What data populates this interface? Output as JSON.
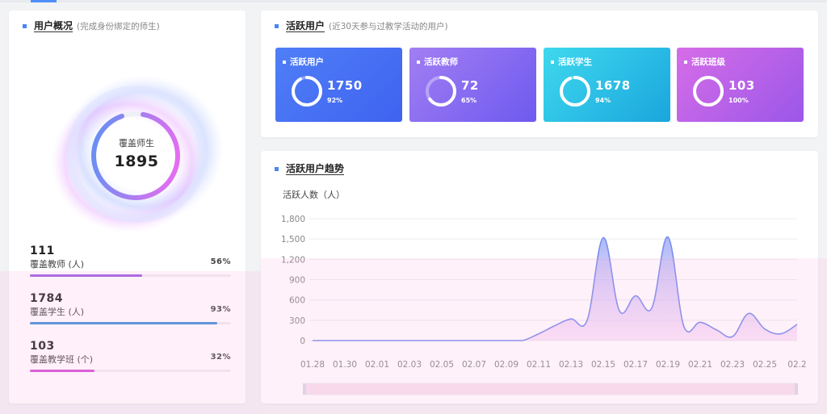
{
  "overview": {
    "title": "用户概况",
    "subtitle": "(完成身份绑定的师生)",
    "center_label": "覆盖师生",
    "center_value": "1895",
    "stats": [
      {
        "value": "111",
        "label": "覆盖教师 (人)",
        "percent": "56%",
        "fraction": 0.56,
        "color": "#9b5de5"
      },
      {
        "value": "1784",
        "label": "覆盖学生 (人)",
        "percent": "93%",
        "fraction": 0.93,
        "color": "#3e8fd8"
      },
      {
        "value": "103",
        "label": "覆盖教学班 (个)",
        "percent": "32%",
        "fraction": 0.32,
        "color": "#d64fd8"
      }
    ]
  },
  "active": {
    "title": "活跃用户",
    "subtitle": "(近30天参与过教学活动的用户)",
    "cards": [
      {
        "title": "活跃用户",
        "value": "1750",
        "percent": "92%",
        "fraction": 0.92,
        "bg_from": "#4f7ff7",
        "bg_to": "#3f62f0"
      },
      {
        "title": "活跃教师",
        "value": "72",
        "percent": "65%",
        "fraction": 0.65,
        "bg_from": "#a27ef2",
        "bg_to": "#6e5af0"
      },
      {
        "title": "活跃学生",
        "value": "1678",
        "percent": "94%",
        "fraction": 0.94,
        "bg_from": "#3fd8ee",
        "bg_to": "#1aa6dd"
      },
      {
        "title": "活跃班级",
        "value": "103",
        "percent": "100%",
        "fraction": 1.0,
        "bg_from": "#d66de8",
        "bg_to": "#9b57e8"
      }
    ]
  },
  "trend": {
    "title": "活跃用户趋势",
    "y_title": "活跃人数（人）"
  },
  "chart_data": {
    "type": "area",
    "ylabel": "活跃人数（人）",
    "ylim": [
      0,
      1800
    ],
    "yticks": [
      "1,800",
      "1,500",
      "1,200",
      "900",
      "600",
      "300",
      "0"
    ],
    "xtick_labels": [
      "01.28",
      "01.30",
      "02.01",
      "02.03",
      "02.05",
      "02.07",
      "02.09",
      "02.11",
      "02.13",
      "02.15",
      "02.17",
      "02.19",
      "02.21",
      "02.23",
      "02.25",
      "02.2"
    ],
    "x": [
      "01.28",
      "01.29",
      "01.30",
      "01.31",
      "02.01",
      "02.02",
      "02.03",
      "02.04",
      "02.05",
      "02.06",
      "02.07",
      "02.08",
      "02.09",
      "02.10",
      "02.11",
      "02.12",
      "02.13",
      "02.14",
      "02.15",
      "02.16",
      "02.17",
      "02.18",
      "02.19",
      "02.20",
      "02.21",
      "02.22",
      "02.23",
      "02.24",
      "02.25",
      "02.26",
      "02.27"
    ],
    "values": [
      0,
      0,
      0,
      0,
      0,
      0,
      0,
      0,
      0,
      0,
      0,
      0,
      0,
      0,
      100,
      220,
      320,
      300,
      1520,
      440,
      660,
      480,
      1530,
      200,
      270,
      160,
      60,
      400,
      170,
      100,
      240
    ],
    "line_color": "#7b8ef0"
  }
}
